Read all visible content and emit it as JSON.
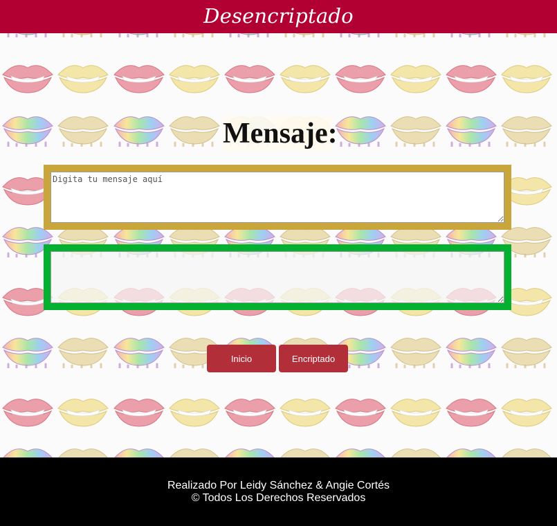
{
  "header": {
    "title": "Desencriptado"
  },
  "main": {
    "heading": "Mensaje:",
    "input": {
      "placeholder": "Digita tu mensaje aquí",
      "value": ""
    },
    "output": {
      "value": ""
    },
    "buttons": {
      "inicio": "Inicio",
      "encriptado": "Encriptado"
    }
  },
  "footer": {
    "credits": "Realizado Por Leidy Sánchez & Angie Cortés",
    "rights": "© Todos Los Derechos Reservados"
  },
  "colors": {
    "header_bg": "#b30033",
    "input_border": "#c9a63c",
    "output_border": "#04b030",
    "button_bg": "#b22f3a",
    "footer_bg": "#000000"
  },
  "background_pattern": "lips-icon"
}
